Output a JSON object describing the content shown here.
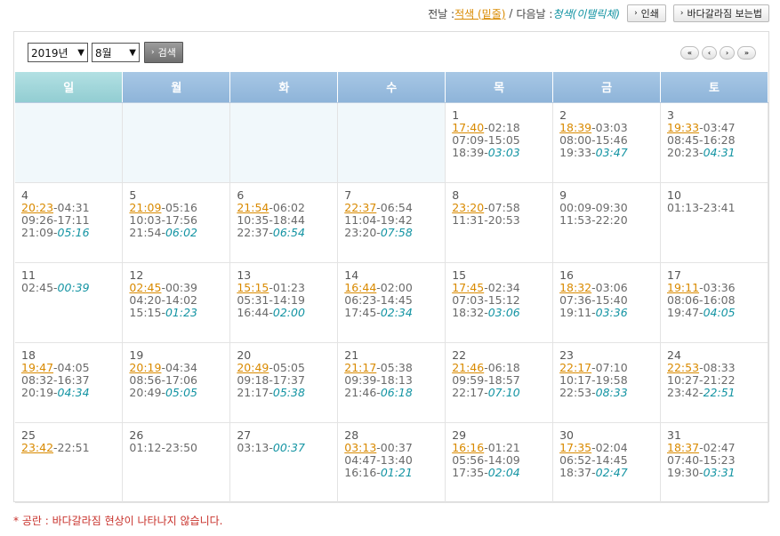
{
  "topbar": {
    "prev_label": "전날 : ",
    "prev_legend": "적색 (밑줄)",
    "separator": "/",
    "next_label": "다음날 : ",
    "next_legend": "청색(이탤릭체)",
    "print_button": "인쇄",
    "howto_button": "바다갈라짐 보는법"
  },
  "search": {
    "year": "2019년",
    "month": "8월",
    "button": "검색"
  },
  "nav": {
    "first": "«",
    "prev": "‹",
    "next": "›",
    "last": "»"
  },
  "weekdays": [
    "일",
    "월",
    "화",
    "수",
    "목",
    "금",
    "토"
  ],
  "weeks": [
    [
      null,
      null,
      null,
      null,
      {
        "day": "1",
        "lines": [
          [
            {
              "t": "17:40",
              "c": "red"
            },
            {
              "t": "-02:18",
              "c": "gray"
            }
          ],
          [
            {
              "t": "07:09-15:05",
              "c": "gray"
            }
          ],
          [
            {
              "t": "18:39-",
              "c": "gray"
            },
            {
              "t": "03:03",
              "c": "blue"
            }
          ]
        ]
      },
      {
        "day": "2",
        "lines": [
          [
            {
              "t": "18:39",
              "c": "red"
            },
            {
              "t": "-03:03",
              "c": "gray"
            }
          ],
          [
            {
              "t": "08:00-15:46",
              "c": "gray"
            }
          ],
          [
            {
              "t": "19:33-",
              "c": "gray"
            },
            {
              "t": "03:47",
              "c": "blue"
            }
          ]
        ]
      },
      {
        "day": "3",
        "lines": [
          [
            {
              "t": "19:33",
              "c": "red"
            },
            {
              "t": "-03:47",
              "c": "gray"
            }
          ],
          [
            {
              "t": "08:45-16:28",
              "c": "gray"
            }
          ],
          [
            {
              "t": "20:23-",
              "c": "gray"
            },
            {
              "t": "04:31",
              "c": "blue"
            }
          ]
        ]
      }
    ],
    [
      {
        "day": "4",
        "lines": [
          [
            {
              "t": "20:23",
              "c": "red"
            },
            {
              "t": "-04:31",
              "c": "gray"
            }
          ],
          [
            {
              "t": "09:26-17:11",
              "c": "gray"
            }
          ],
          [
            {
              "t": "21:09-",
              "c": "gray"
            },
            {
              "t": "05:16",
              "c": "blue"
            }
          ]
        ]
      },
      {
        "day": "5",
        "lines": [
          [
            {
              "t": "21:09",
              "c": "red"
            },
            {
              "t": "-05:16",
              "c": "gray"
            }
          ],
          [
            {
              "t": "10:03-17:56",
              "c": "gray"
            }
          ],
          [
            {
              "t": "21:54-",
              "c": "gray"
            },
            {
              "t": "06:02",
              "c": "blue"
            }
          ]
        ]
      },
      {
        "day": "6",
        "lines": [
          [
            {
              "t": "21:54",
              "c": "red"
            },
            {
              "t": "-06:02",
              "c": "gray"
            }
          ],
          [
            {
              "t": "10:35-18:44",
              "c": "gray"
            }
          ],
          [
            {
              "t": "22:37-",
              "c": "gray"
            },
            {
              "t": "06:54",
              "c": "blue"
            }
          ]
        ]
      },
      {
        "day": "7",
        "lines": [
          [
            {
              "t": "22:37",
              "c": "red"
            },
            {
              "t": "-06:54",
              "c": "gray"
            }
          ],
          [
            {
              "t": "11:04-19:42",
              "c": "gray"
            }
          ],
          [
            {
              "t": "23:20-",
              "c": "gray"
            },
            {
              "t": "07:58",
              "c": "blue"
            }
          ]
        ]
      },
      {
        "day": "8",
        "lines": [
          [
            {
              "t": "23:20",
              "c": "red"
            },
            {
              "t": "-07:58",
              "c": "gray"
            }
          ],
          [
            {
              "t": "11:31-20:53",
              "c": "gray"
            }
          ]
        ]
      },
      {
        "day": "9",
        "lines": [
          [
            {
              "t": "00:09-09:30",
              "c": "gray"
            }
          ],
          [
            {
              "t": "11:53-22:20",
              "c": "gray"
            }
          ]
        ]
      },
      {
        "day": "10",
        "lines": [
          [
            {
              "t": "01:13-23:41",
              "c": "gray"
            }
          ]
        ]
      }
    ],
    [
      {
        "day": "11",
        "lines": [
          [
            {
              "t": "02:45-",
              "c": "gray"
            },
            {
              "t": "00:39",
              "c": "blue"
            }
          ]
        ]
      },
      {
        "day": "12",
        "lines": [
          [
            {
              "t": "02:45",
              "c": "red"
            },
            {
              "t": "-00:39",
              "c": "gray"
            }
          ],
          [
            {
              "t": "04:20-14:02",
              "c": "gray"
            }
          ],
          [
            {
              "t": "15:15-",
              "c": "gray"
            },
            {
              "t": "01:23",
              "c": "blue"
            }
          ]
        ]
      },
      {
        "day": "13",
        "lines": [
          [
            {
              "t": "15:15",
              "c": "red"
            },
            {
              "t": "-01:23",
              "c": "gray"
            }
          ],
          [
            {
              "t": "05:31-14:19",
              "c": "gray"
            }
          ],
          [
            {
              "t": "16:44-",
              "c": "gray"
            },
            {
              "t": "02:00",
              "c": "blue"
            }
          ]
        ]
      },
      {
        "day": "14",
        "lines": [
          [
            {
              "t": "16:44",
              "c": "red"
            },
            {
              "t": "-02:00",
              "c": "gray"
            }
          ],
          [
            {
              "t": "06:23-14:45",
              "c": "gray"
            }
          ],
          [
            {
              "t": "17:45-",
              "c": "gray"
            },
            {
              "t": "02:34",
              "c": "blue"
            }
          ]
        ]
      },
      {
        "day": "15",
        "lines": [
          [
            {
              "t": "17:45",
              "c": "red"
            },
            {
              "t": "-02:34",
              "c": "gray"
            }
          ],
          [
            {
              "t": "07:03-15:12",
              "c": "gray"
            }
          ],
          [
            {
              "t": "18:32-",
              "c": "gray"
            },
            {
              "t": "03:06",
              "c": "blue"
            }
          ]
        ]
      },
      {
        "day": "16",
        "lines": [
          [
            {
              "t": "18:32",
              "c": "red"
            },
            {
              "t": "-03:06",
              "c": "gray"
            }
          ],
          [
            {
              "t": "07:36-15:40",
              "c": "gray"
            }
          ],
          [
            {
              "t": "19:11-",
              "c": "gray"
            },
            {
              "t": "03:36",
              "c": "blue"
            }
          ]
        ]
      },
      {
        "day": "17",
        "lines": [
          [
            {
              "t": "19:11",
              "c": "red"
            },
            {
              "t": "-03:36",
              "c": "gray"
            }
          ],
          [
            {
              "t": "08:06-16:08",
              "c": "gray"
            }
          ],
          [
            {
              "t": "19:47-",
              "c": "gray"
            },
            {
              "t": "04:05",
              "c": "blue"
            }
          ]
        ]
      }
    ],
    [
      {
        "day": "18",
        "lines": [
          [
            {
              "t": "19:47",
              "c": "red"
            },
            {
              "t": "-04:05",
              "c": "gray"
            }
          ],
          [
            {
              "t": "08:32-16:37",
              "c": "gray"
            }
          ],
          [
            {
              "t": "20:19-",
              "c": "gray"
            },
            {
              "t": "04:34",
              "c": "blue"
            }
          ]
        ]
      },
      {
        "day": "19",
        "lines": [
          [
            {
              "t": "20:19",
              "c": "red"
            },
            {
              "t": "-04:34",
              "c": "gray"
            }
          ],
          [
            {
              "t": "08:56-17:06",
              "c": "gray"
            }
          ],
          [
            {
              "t": "20:49-",
              "c": "gray"
            },
            {
              "t": "05:05",
              "c": "blue"
            }
          ]
        ]
      },
      {
        "day": "20",
        "lines": [
          [
            {
              "t": "20:49",
              "c": "red"
            },
            {
              "t": "-05:05",
              "c": "gray"
            }
          ],
          [
            {
              "t": "09:18-17:37",
              "c": "gray"
            }
          ],
          [
            {
              "t": "21:17-",
              "c": "gray"
            },
            {
              "t": "05:38",
              "c": "blue"
            }
          ]
        ]
      },
      {
        "day": "21",
        "lines": [
          [
            {
              "t": "21:17",
              "c": "red"
            },
            {
              "t": "-05:38",
              "c": "gray"
            }
          ],
          [
            {
              "t": "09:39-18:13",
              "c": "gray"
            }
          ],
          [
            {
              "t": "21:46-",
              "c": "gray"
            },
            {
              "t": "06:18",
              "c": "blue"
            }
          ]
        ]
      },
      {
        "day": "22",
        "lines": [
          [
            {
              "t": "21:46",
              "c": "red"
            },
            {
              "t": "-06:18",
              "c": "gray"
            }
          ],
          [
            {
              "t": "09:59-18:57",
              "c": "gray"
            }
          ],
          [
            {
              "t": "22:17-",
              "c": "gray"
            },
            {
              "t": "07:10",
              "c": "blue"
            }
          ]
        ]
      },
      {
        "day": "23",
        "lines": [
          [
            {
              "t": "22:17",
              "c": "red"
            },
            {
              "t": "-07:10",
              "c": "gray"
            }
          ],
          [
            {
              "t": "10:17-19:58",
              "c": "gray"
            }
          ],
          [
            {
              "t": "22:53-",
              "c": "gray"
            },
            {
              "t": "08:33",
              "c": "blue"
            }
          ]
        ]
      },
      {
        "day": "24",
        "lines": [
          [
            {
              "t": "22:53",
              "c": "red"
            },
            {
              "t": "-08:33",
              "c": "gray"
            }
          ],
          [
            {
              "t": "10:27-21:22",
              "c": "gray"
            }
          ],
          [
            {
              "t": "23:42-",
              "c": "gray"
            },
            {
              "t": "22:51",
              "c": "blue"
            }
          ]
        ]
      }
    ],
    [
      {
        "day": "25",
        "lines": [
          [
            {
              "t": "23:42",
              "c": "red"
            },
            {
              "t": "-22:51",
              "c": "gray"
            }
          ]
        ]
      },
      {
        "day": "26",
        "lines": [
          [
            {
              "t": "01:12-23:50",
              "c": "gray"
            }
          ]
        ]
      },
      {
        "day": "27",
        "lines": [
          [
            {
              "t": "03:13-",
              "c": "gray"
            },
            {
              "t": "00:37",
              "c": "blue"
            }
          ]
        ]
      },
      {
        "day": "28",
        "lines": [
          [
            {
              "t": "03:13",
              "c": "red"
            },
            {
              "t": "-00:37",
              "c": "gray"
            }
          ],
          [
            {
              "t": "04:47-13:40",
              "c": "gray"
            }
          ],
          [
            {
              "t": "16:16-",
              "c": "gray"
            },
            {
              "t": "01:21",
              "c": "blue"
            }
          ]
        ]
      },
      {
        "day": "29",
        "lines": [
          [
            {
              "t": "16:16",
              "c": "red"
            },
            {
              "t": "-01:21",
              "c": "gray"
            }
          ],
          [
            {
              "t": "05:56-14:09",
              "c": "gray"
            }
          ],
          [
            {
              "t": "17:35-",
              "c": "gray"
            },
            {
              "t": "02:04",
              "c": "blue"
            }
          ]
        ]
      },
      {
        "day": "30",
        "lines": [
          [
            {
              "t": "17:35",
              "c": "red"
            },
            {
              "t": "-02:04",
              "c": "gray"
            }
          ],
          [
            {
              "t": "06:52-14:45",
              "c": "gray"
            }
          ],
          [
            {
              "t": "18:37-",
              "c": "gray"
            },
            {
              "t": "02:47",
              "c": "blue"
            }
          ]
        ]
      },
      {
        "day": "31",
        "lines": [
          [
            {
              "t": "18:37",
              "c": "red"
            },
            {
              "t": "-02:47",
              "c": "gray"
            }
          ],
          [
            {
              "t": "07:40-15:23",
              "c": "gray"
            }
          ],
          [
            {
              "t": "19:30-",
              "c": "gray"
            },
            {
              "t": "03:31",
              "c": "blue"
            }
          ]
        ]
      }
    ]
  ],
  "note": "* 공란 : 바다갈라짐 현상이 나타나지 않습니다.",
  "colors": {
    "prev_day": "#d98a00",
    "next_day": "#1494a3",
    "header": "#9dbfe1",
    "header_sunday": "#a2d7db",
    "note": "#c8312b"
  }
}
